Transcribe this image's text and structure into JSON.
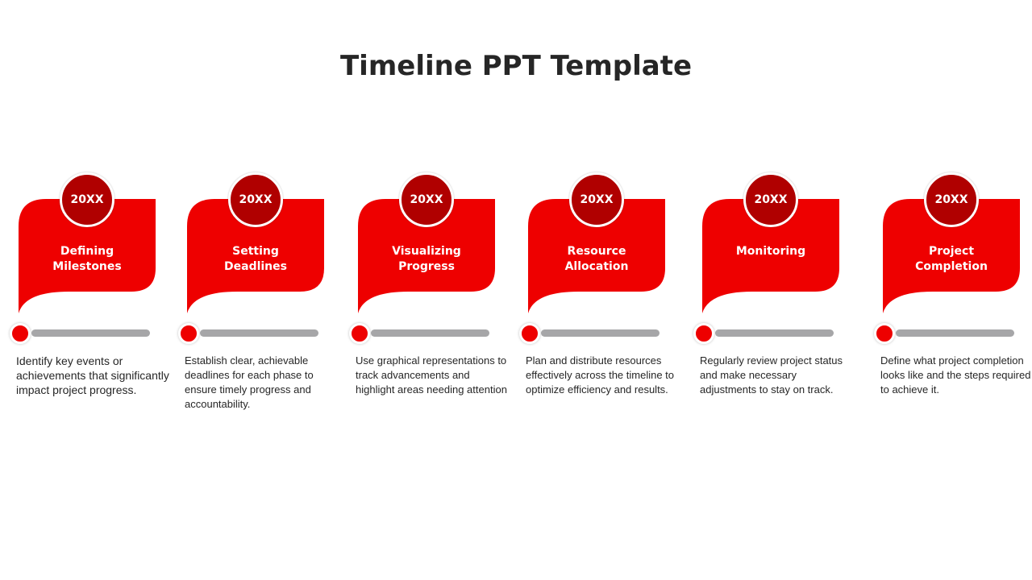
{
  "title": "Timeline PPT Template",
  "colors": {
    "card": "#EE0000",
    "year_circle": "#B00000",
    "bar": "#A6A6A8",
    "text": "#262626"
  },
  "steps": [
    {
      "year": "20XX",
      "title_lines": [
        "Defining",
        "Milestones"
      ],
      "description": "Identify key events or achievements that significantly impact project progress."
    },
    {
      "year": "20XX",
      "title_lines": [
        "Setting",
        "Deadlines"
      ],
      "description": "Establish clear, achievable deadlines for each phase to ensure timely progress and accountability."
    },
    {
      "year": "20XX",
      "title_lines": [
        "Visualizing",
        "Progress"
      ],
      "description": "Use graphical representations to track advancements and highlight areas needing attention"
    },
    {
      "year": "20XX",
      "title_lines": [
        "Resource",
        "Allocation"
      ],
      "description": "Plan and distribute resources effectively across the timeline to optimize efficiency and results."
    },
    {
      "year": "20XX",
      "title_lines": [
        "Monitoring"
      ],
      "description": "Regularly review project status and make necessary adjustments to stay on track."
    },
    {
      "year": "20XX",
      "title_lines": [
        "Project",
        "Completion"
      ],
      "description": "Define what project completion looks like and the steps required to achieve it."
    }
  ]
}
